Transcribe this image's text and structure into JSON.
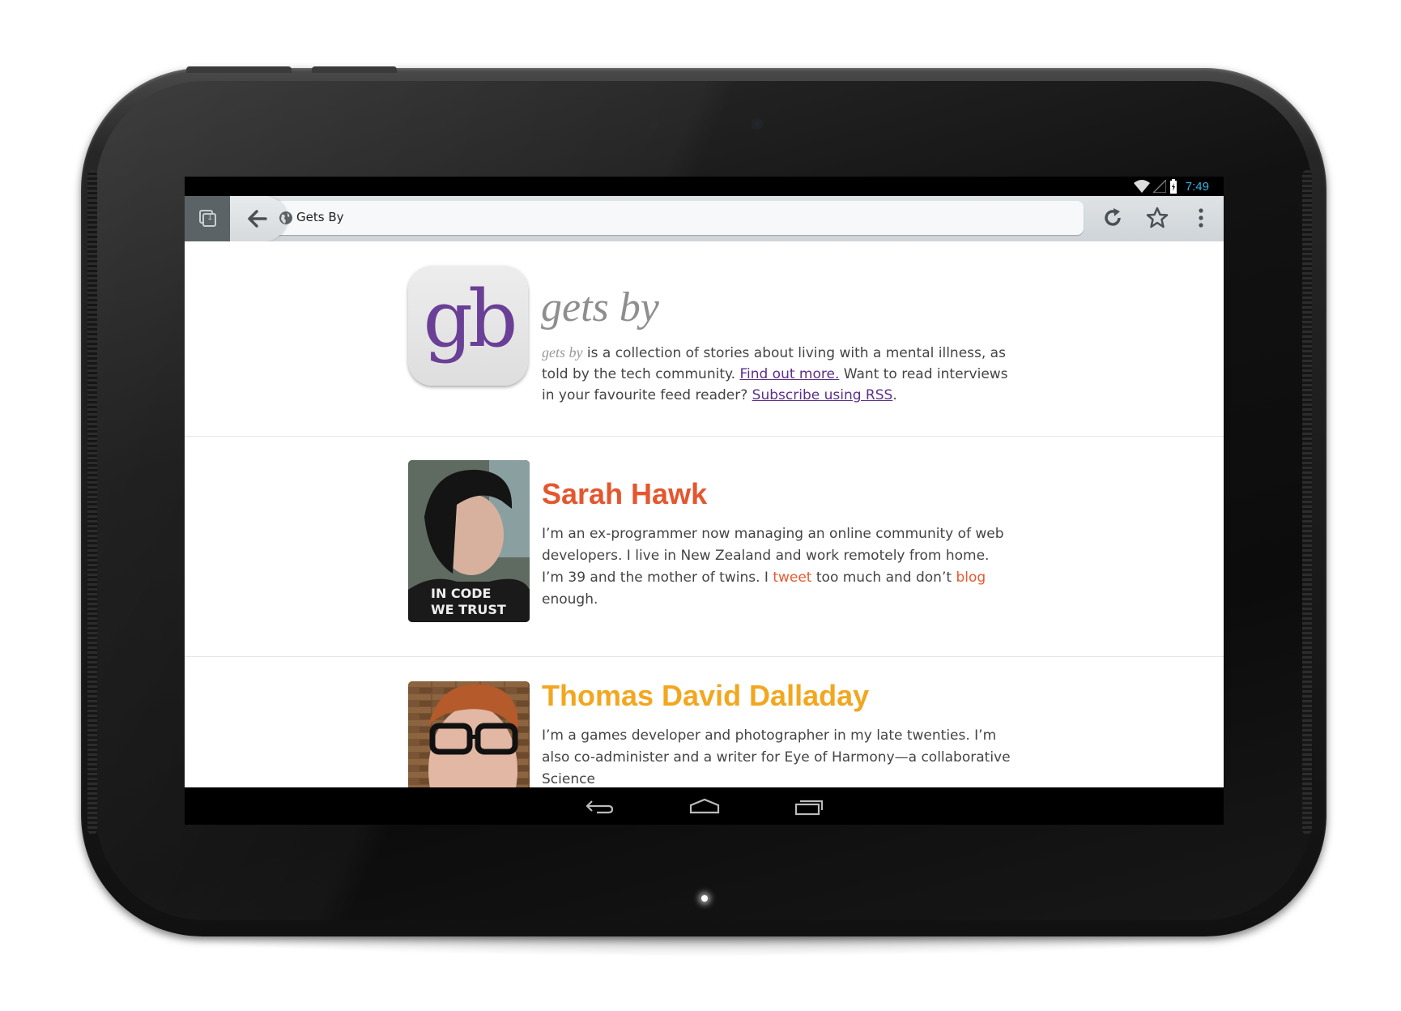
{
  "status": {
    "time": "7:49"
  },
  "browser": {
    "tab_count": "1",
    "url_title": "Gets By"
  },
  "site": {
    "logo": "gb",
    "title": "gets by",
    "intro_em": "gets by",
    "intro_1": " is a collection of stories about living with a mental illness, as told by the tech community. ",
    "find_out_link": "Find out more.",
    "intro_2": " Want to read interviews in your favourite feed reader? ",
    "rss_link": "Subscribe using RSS",
    "intro_3": "."
  },
  "people": [
    {
      "name": "Sarah Hawk",
      "color": "#e4572e",
      "bio_1": "I’m an ex-programmer now managing an online community of web developers. I live in New Zealand and work remotely from home. I’m 39 and the mother of twins. I ",
      "tweet_link": "tweet",
      "bio_2": " too much and don’t ",
      "blog_link": "blog",
      "bio_3": " enough.",
      "shirt_text": "IN CODE WE TRUST"
    },
    {
      "name": "Thomas David Dalladay",
      "color": "#f2a720",
      "bio": "I’m a games developer and photographer in my late twenties. I’m also co-administer and a writer for Eye of Harmony—a collaborative Science"
    }
  ],
  "colors": {
    "accent_purple": "#5b2e8a",
    "link_orange": "#e75b2f",
    "clock_blue": "#33b5e5"
  }
}
